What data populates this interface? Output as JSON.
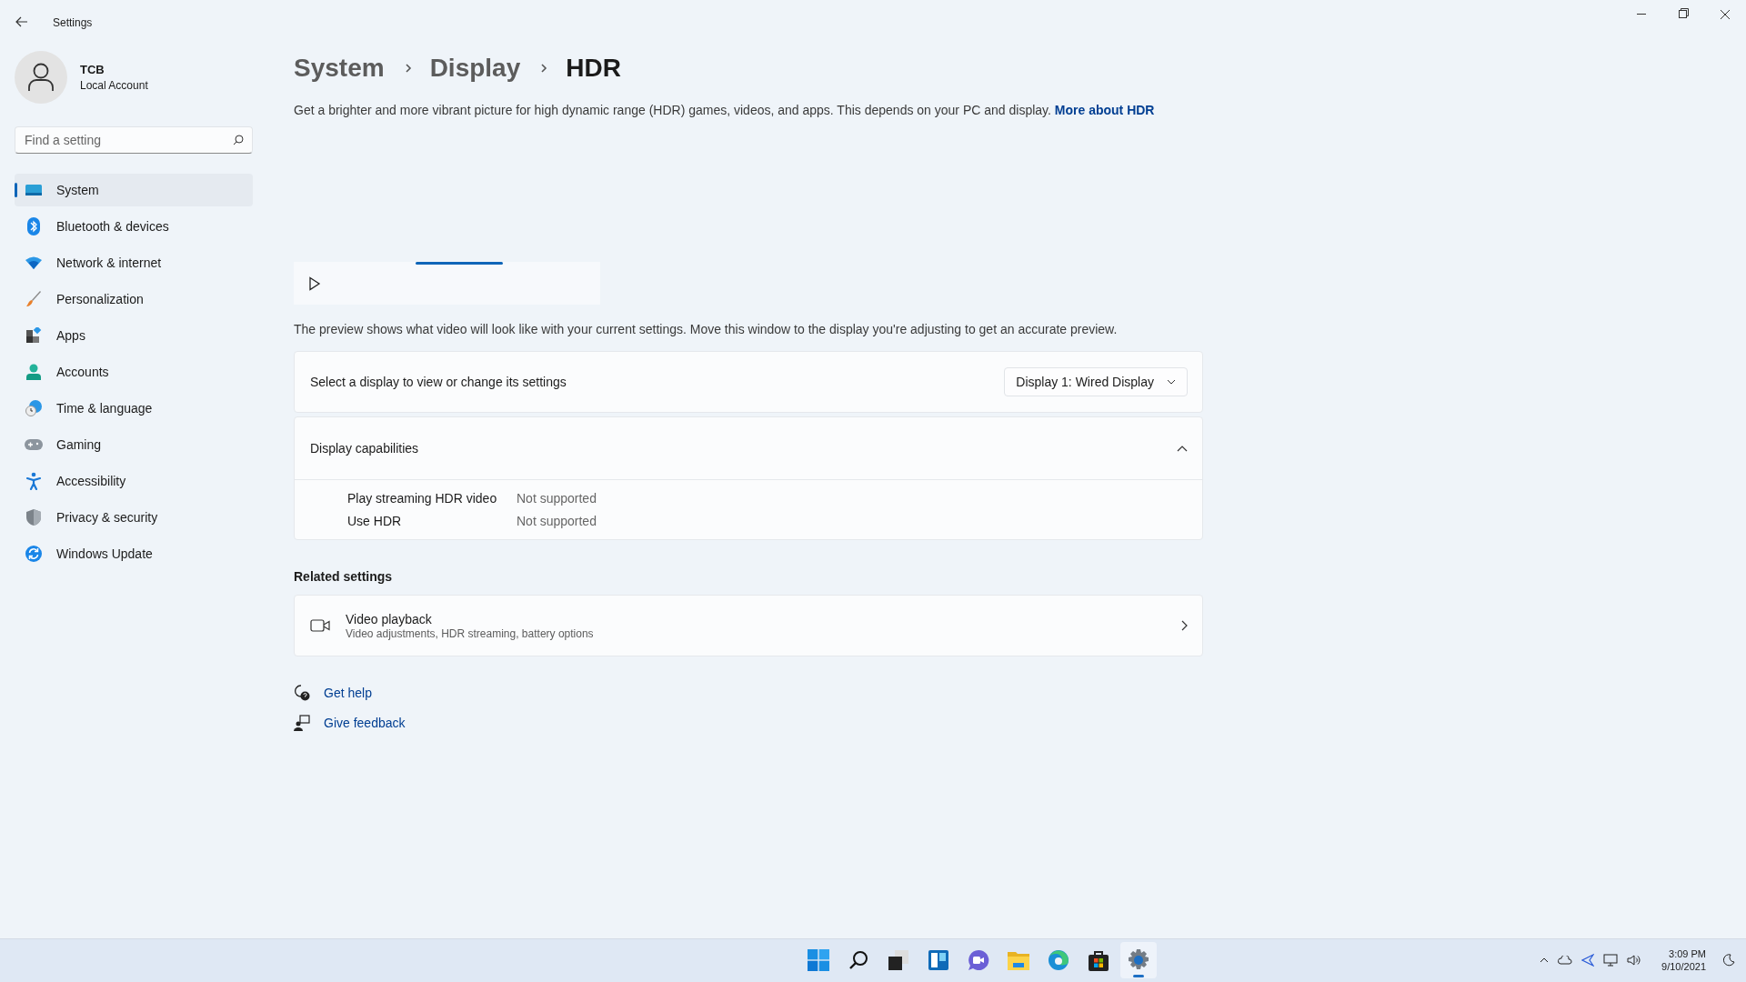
{
  "window": {
    "title": "Settings"
  },
  "account": {
    "name": "TCB",
    "type": "Local Account"
  },
  "search": {
    "placeholder": "Find a setting"
  },
  "nav": [
    {
      "kind": "system",
      "label": "System",
      "selected": true
    },
    {
      "kind": "bluetooth",
      "label": "Bluetooth & devices",
      "selected": false
    },
    {
      "kind": "network",
      "label": "Network & internet",
      "selected": false
    },
    {
      "kind": "brush",
      "label": "Personalization",
      "selected": false
    },
    {
      "kind": "apps",
      "label": "Apps",
      "selected": false
    },
    {
      "kind": "accounts",
      "label": "Accounts",
      "selected": false
    },
    {
      "kind": "time",
      "label": "Time & language",
      "selected": false
    },
    {
      "kind": "gaming",
      "label": "Gaming",
      "selected": false
    },
    {
      "kind": "accessibility",
      "label": "Accessibility",
      "selected": false
    },
    {
      "kind": "privacy",
      "label": "Privacy & security",
      "selected": false
    },
    {
      "kind": "update",
      "label": "Windows Update",
      "selected": false
    }
  ],
  "breadcrumb": [
    "System",
    "Display",
    "HDR"
  ],
  "description": {
    "text": "Get a brighter and more vibrant picture for high dynamic range (HDR) games, videos, and apps. This depends on your PC and display.",
    "link": "More about HDR"
  },
  "preview": {
    "caption": "The preview shows what video will look like with your current settings. Move this window to the display you're adjusting to get an accurate preview."
  },
  "display_select": {
    "label": "Select a display to view or change its settings",
    "value": "Display 1: Wired Display"
  },
  "capabilities": {
    "title": "Display capabilities",
    "expanded": true,
    "rows": [
      {
        "name": "Play streaming HDR video",
        "value": "Not supported"
      },
      {
        "name": "Use HDR",
        "value": "Not supported"
      }
    ]
  },
  "related": {
    "heading": "Related settings",
    "items": [
      {
        "kind": "video",
        "title": "Video playback",
        "subtitle": "Video adjustments, HDR streaming, battery options"
      }
    ]
  },
  "help_links": [
    {
      "kind": "help",
      "label": "Get help"
    },
    {
      "kind": "feedback",
      "label": "Give feedback"
    }
  ],
  "taskbar": {
    "apps": [
      {
        "kind": "start",
        "active": false
      },
      {
        "kind": "search",
        "active": false
      },
      {
        "kind": "taskview",
        "active": false
      },
      {
        "kind": "widgets",
        "active": false
      },
      {
        "kind": "chat",
        "active": false
      },
      {
        "kind": "explorer",
        "active": false
      },
      {
        "kind": "edge",
        "active": false
      },
      {
        "kind": "store",
        "active": false
      },
      {
        "kind": "settings",
        "active": true
      }
    ]
  },
  "tray": {
    "time": "3:09 PM",
    "date": "9/10/2021"
  }
}
